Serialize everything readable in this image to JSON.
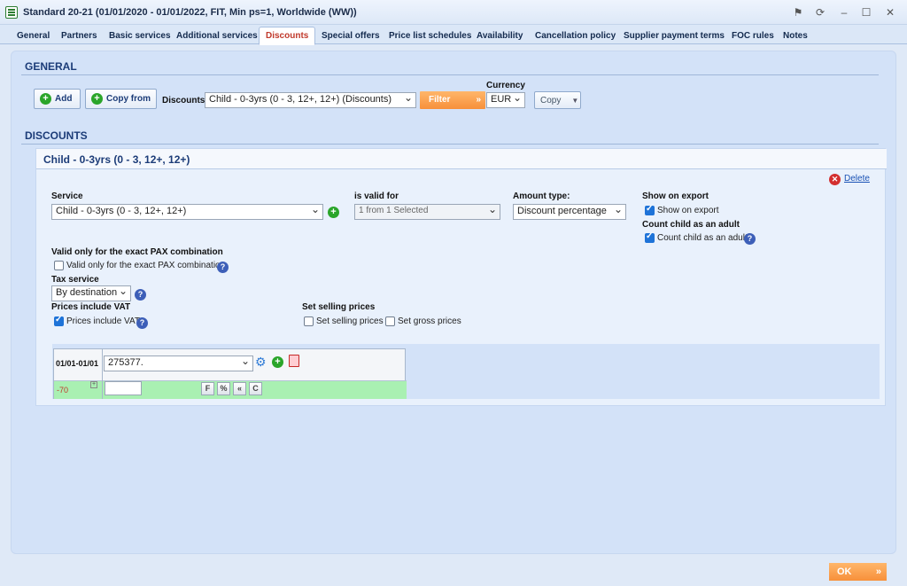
{
  "window": {
    "title": "Standard 20-21 (01/01/2020 - 01/01/2022, FIT, Min ps=1, Worldwide (WW))",
    "controls": [
      "pin",
      "refresh",
      "minimize",
      "maximize",
      "close"
    ]
  },
  "tabs": [
    {
      "label": "General"
    },
    {
      "label": "Partners"
    },
    {
      "label": "Basic services"
    },
    {
      "label": "Additional services"
    },
    {
      "label": "Discounts",
      "active": true
    },
    {
      "label": "Special offers"
    },
    {
      "label": "Price list schedules"
    },
    {
      "label": "Availability"
    },
    {
      "label": "Cancellation policy"
    },
    {
      "label": "Supplier payment terms"
    },
    {
      "label": "FOC rules"
    },
    {
      "label": "Notes"
    }
  ],
  "general": {
    "title": "GENERAL",
    "add_label": "Add",
    "copy_from_label": "Copy from",
    "discounts_label": "Discounts",
    "discounts_value": "Child  - 0-3yrs  (0 - 3, 12+, 12+) (Discounts)",
    "filter_label": "Filter",
    "currency_label": "Currency",
    "currency_value": "EUR",
    "copy_label": "Copy"
  },
  "discounts": {
    "title": "DISCOUNTS",
    "panel_title": "Child - 0-3yrs (0 - 3, 12+, 12+)",
    "delete_label": "Delete",
    "service_label": "Service",
    "service_value": "Child - 0-3yrs (0 - 3, 12+, 12+)",
    "valid_for_label": "is valid for",
    "valid_for_value": "1 from 1 Selected",
    "amount_type_label": "Amount type:",
    "amount_type_value": "Discount percentage",
    "show_on_export_label": "Show on export",
    "show_on_export_checkbox": "Show on export",
    "count_child_label": "Count child as an adult",
    "count_child_checkbox": "Count child as an adult",
    "exact_pax_label": "Valid only for the exact PAX combination",
    "exact_pax_checkbox": "Valid only for the exact PAX combination",
    "tax_service_label": "Tax service",
    "tax_service_value": "By destination",
    "prices_vat_label": "Prices include VAT",
    "prices_vat_checkbox": "Prices include VAT",
    "set_selling_label": "Set selling prices",
    "set_selling_checkbox": "Set selling prices",
    "set_gross_checkbox": "Set gross prices",
    "checks": {
      "show_on_export": true,
      "count_child": true,
      "exact_pax": false,
      "prices_vat": true,
      "set_selling": false,
      "set_gross": false
    }
  },
  "price_grid": {
    "period": "01/01-01/01",
    "price_select": "275377.",
    "row_value": "-70",
    "buttons": [
      "F",
      "%",
      "«",
      "C"
    ]
  },
  "footer": {
    "ok_label": "OK"
  },
  "colors": {
    "accent_orange": "#f7903a",
    "active_tab": "#c0392b",
    "section_title": "#1c3c78",
    "grid_row": "#a9f0b2"
  }
}
